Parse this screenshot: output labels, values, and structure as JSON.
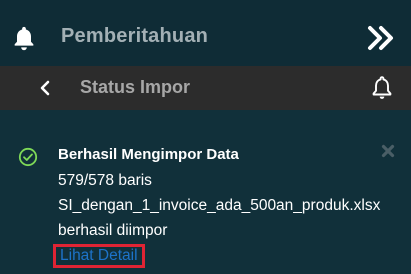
{
  "header": {
    "title": "Pemberitahuan",
    "bell_icon": "bell-icon",
    "collapse_icon": "double-chevron-right-icon"
  },
  "subbar": {
    "title": "Status Impor",
    "back_icon": "chevron-left-icon",
    "bell_icon": "bell-outline-icon"
  },
  "notification": {
    "status_icon": "check-circle-icon",
    "title": "Berhasil Mengimpor Data",
    "count_text": "579/578 baris",
    "filename": "SI_dengan_1_invoice_ada_500an_produk.xlsx",
    "status_text": "berhasil diimpor",
    "detail_link": "Lihat Detail",
    "close_icon": "close-icon"
  },
  "colors": {
    "header_bg": "#0f2c36",
    "subbar_bg": "#2c2c2c",
    "content_bg": "#11303a",
    "success": "#7ed957",
    "link": "#1d73c9",
    "highlight": "#e02434"
  }
}
